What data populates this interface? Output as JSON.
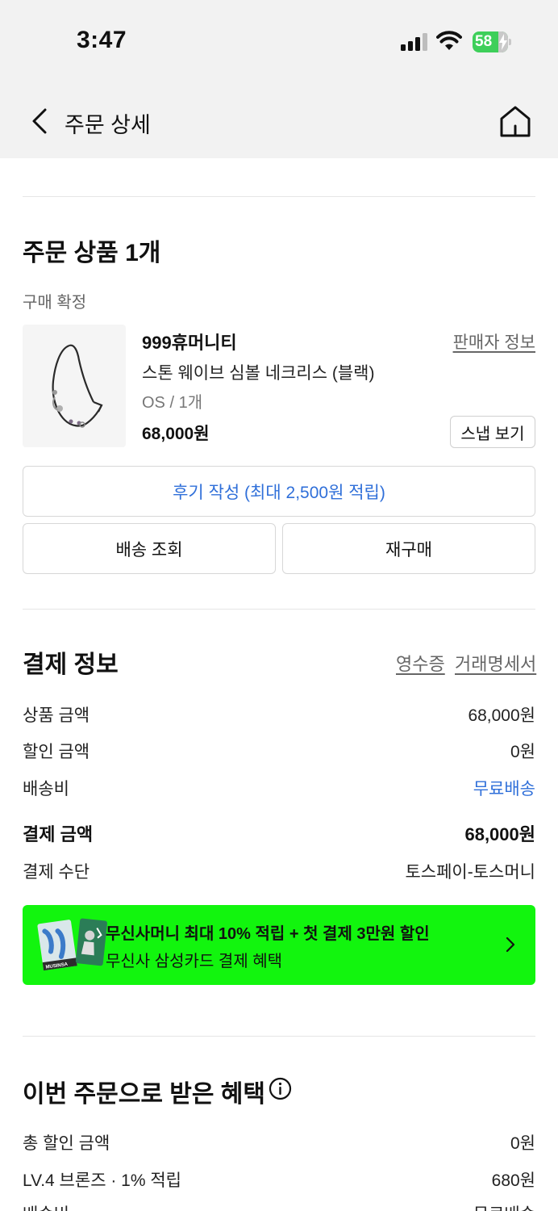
{
  "status_bar": {
    "time": "3:47",
    "battery": "58"
  },
  "nav": {
    "title": "주문 상세"
  },
  "order_products": {
    "title": "주문 상품 1개",
    "status": "구매 확정",
    "item": {
      "brand": "999휴머니티",
      "seller_info_label": "판매자 정보",
      "name": "스톤 웨이브 심볼 네크리스 (블랙)",
      "option": "OS / 1개",
      "price": "68,000원",
      "snap_label": "스냅 보기"
    },
    "review_button": "후기 작성 (최대 2,500원 적립)",
    "delivery_button": "배송 조회",
    "rebuy_button": "재구매"
  },
  "payment_info": {
    "title": "결제 정보",
    "receipt_link": "영수증",
    "statement_link": "거래명세서",
    "rows": [
      {
        "label": "상품 금액",
        "value": "68,000원"
      },
      {
        "label": "할인 금액",
        "value": "0원"
      },
      {
        "label": "배송비",
        "value": "무료배송"
      },
      {
        "label": "결제 금액",
        "value": "68,000원"
      },
      {
        "label": "결제 수단",
        "value": "토스페이-토스머니"
      }
    ]
  },
  "promo": {
    "title": "무신사머니 최대 10% 적립 + 첫 결제 3만원 할인",
    "subtitle": "무신사 삼성카드 결제 혜택",
    "image_text": "MUSINSA"
  },
  "benefits": {
    "title": "이번 주문으로 받은 혜택",
    "rows": [
      {
        "label": "총 할인 금액",
        "value": "0원"
      },
      {
        "label": "LV.4 브론즈 · 1% 적립",
        "value": "680원"
      },
      {
        "label": "배송비",
        "value": "무료배송"
      }
    ]
  },
  "colors": {
    "accent_blue": "#2f6fd9",
    "promo_green": "#12f50e",
    "battery_green": "#3ecf5a"
  }
}
